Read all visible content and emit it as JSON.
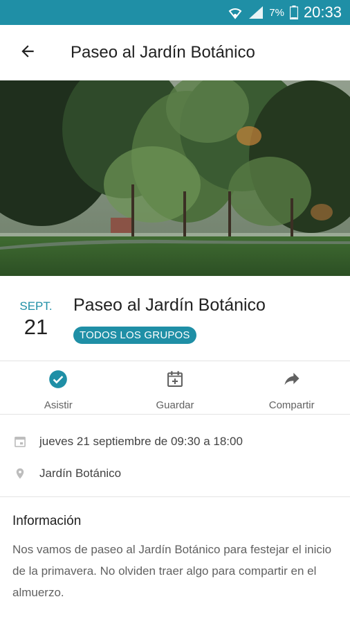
{
  "status_bar": {
    "battery": "7%",
    "time": "20:33",
    "icons": [
      "wifi-icon",
      "signal-icon",
      "battery-icon"
    ],
    "background": "#1f8fa6"
  },
  "app_bar": {
    "title": "Paseo al Jardín Botánico",
    "back_icon": "arrow-back-icon"
  },
  "event": {
    "month": "SEPT.",
    "day": "21",
    "title": "Paseo al Jardín Botánico",
    "group_badge": "TODOS LOS GRUPOS",
    "accent_color": "#1f8fa6"
  },
  "actions": [
    {
      "label": "Asistir",
      "icon": "check-circle-icon"
    },
    {
      "label": "Guardar",
      "icon": "calendar-add-icon"
    },
    {
      "label": "Compartir",
      "icon": "share-icon"
    }
  ],
  "details": {
    "datetime": "jueves 21 septiembre de 09:30 a 18:00",
    "location": "Jardín Botánico"
  },
  "info": {
    "heading": "Información",
    "body": "Nos vamos de paseo al Jardín Botánico para festejar el inicio de la primavera. No olviden traer algo para compartir en el almuerzo."
  }
}
